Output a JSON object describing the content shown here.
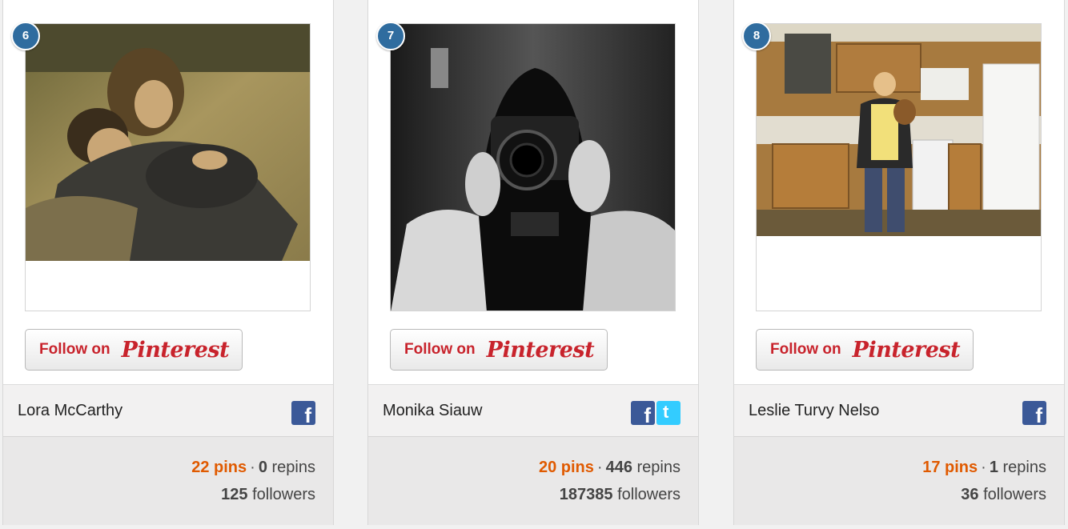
{
  "cards": [
    {
      "rank": "6",
      "name": "Lora McCarthy",
      "follow_text": "Follow on",
      "follow_brand": "Pinterest",
      "socials": [
        "facebook-icon"
      ],
      "pins": "22 pins",
      "separator": "·",
      "repins_count": "0",
      "repins_label": "repins",
      "followers_count": "125",
      "followers_label": "followers"
    },
    {
      "rank": "7",
      "name": "Monika Siauw",
      "follow_text": "Follow on",
      "follow_brand": "Pinterest",
      "socials": [
        "facebook-icon",
        "twitter-icon"
      ],
      "pins": "20 pins",
      "separator": "·",
      "repins_count": "446",
      "repins_label": "repins",
      "followers_count": "187385",
      "followers_label": "followers"
    },
    {
      "rank": "8",
      "name": "Leslie Turvy Nelso",
      "follow_text": "Follow on",
      "follow_brand": "Pinterest",
      "socials": [
        "facebook-icon"
      ],
      "pins": "17 pins",
      "separator": "·",
      "repins_count": "1",
      "repins_label": "repins",
      "followers_count": "36",
      "followers_label": "followers"
    }
  ],
  "icons": {
    "facebook_glyph": "f",
    "twitter_glyph": "t"
  },
  "colors": {
    "rank_badge": "#2f6c9f",
    "pinterest_red": "#c8232c",
    "pins_orange": "#e05a00",
    "facebook_blue": "#3b5998",
    "twitter_blue": "#33ccff"
  }
}
